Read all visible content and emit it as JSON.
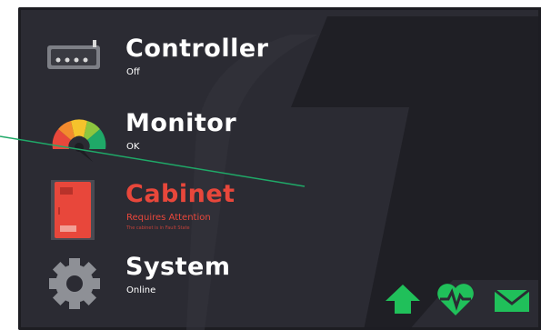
{
  "menu": {
    "items": [
      {
        "title": "Controller",
        "status": "Off",
        "detail": ""
      },
      {
        "title": "Monitor",
        "status": "OK",
        "detail": ""
      },
      {
        "title": "Cabinet",
        "status": "Requires Attention",
        "detail": "The cabinet is in Fault State"
      },
      {
        "title": "System",
        "status": "Online",
        "detail": ""
      }
    ]
  },
  "quick_actions": [
    {
      "icon": "home-arrow-icon"
    },
    {
      "icon": "heartbeat-icon"
    },
    {
      "icon": "mail-icon"
    }
  ],
  "colors": {
    "background": "#2b2b33",
    "text_normal": "#ffffff",
    "text_alert": "#e8473b",
    "accent_green": "#20c05a",
    "pointer_line": "#1fa968"
  }
}
